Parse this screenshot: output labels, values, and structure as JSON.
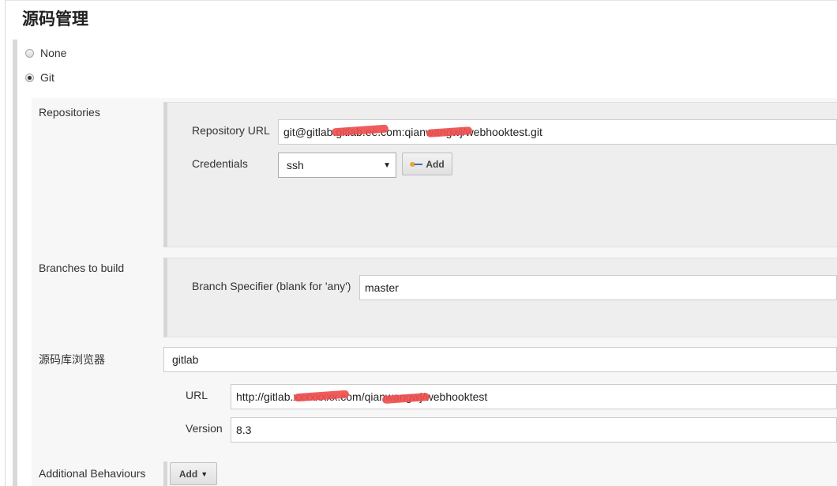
{
  "section": {
    "title": "源码管理"
  },
  "scm_options": [
    {
      "label": "None",
      "checked": false
    },
    {
      "label": "Git",
      "checked": true
    }
  ],
  "repositories": {
    "label": "Repositories",
    "url_label": "Repository URL",
    "url_value": "git@gitlab.gitlab.ee.com:qianwangwj/webhooktest.git",
    "credentials_label": "Credentials",
    "credentials_value": "ssh",
    "add_button_label": "Add"
  },
  "branches": {
    "label": "Branches to build",
    "specifier_label": "Branch Specifier (blank for 'any')",
    "specifier_value": "master"
  },
  "browser": {
    "label": "源码库浏览器",
    "value": "gitlab",
    "url_label": "URL",
    "url_value": "http://gitlab.xxxxxxxx.com/qianwangwj/webhooktest",
    "version_label": "Version",
    "version_value": "8.3"
  },
  "additional": {
    "label": "Additional Behaviours",
    "add_button_label": "Add"
  },
  "colors": {
    "redaction": "#ee4e4e"
  },
  "icons": {
    "credentials_add": "key-icon",
    "dropdown": "caret-down-icon"
  }
}
